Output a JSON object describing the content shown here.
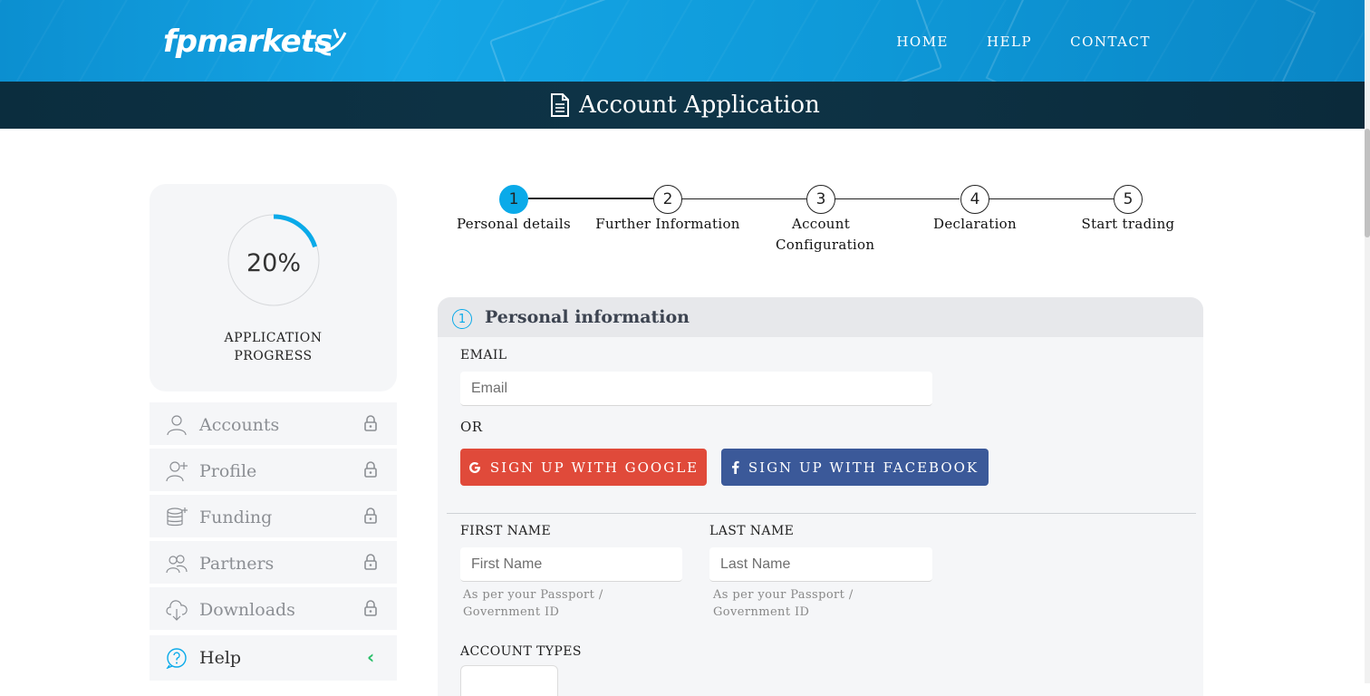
{
  "brand": {
    "logo_text": "fpmarkets"
  },
  "nav": {
    "items": [
      "HOME",
      "HELP",
      "CONTACT"
    ]
  },
  "titlebar": {
    "title": "Account Application"
  },
  "progress": {
    "value": 0.2,
    "value_label": "20%",
    "label_line1": "APPLICATION",
    "label_line2": "PROGRESS",
    "accent": "#0aaae9"
  },
  "sidebar": {
    "items": [
      {
        "label": "Accounts",
        "icon": "user-icon",
        "locked": true
      },
      {
        "label": "Profile",
        "icon": "user-plus-icon",
        "locked": true
      },
      {
        "label": "Funding",
        "icon": "coins-icon",
        "locked": true
      },
      {
        "label": "Partners",
        "icon": "users-icon",
        "locked": true
      },
      {
        "label": "Downloads",
        "icon": "cloud-download-icon",
        "locked": true
      },
      {
        "label": "Help",
        "icon": "help-icon",
        "chevron": "‹"
      }
    ]
  },
  "stepper": {
    "active": 1,
    "steps": [
      {
        "num": "1",
        "label": "Personal details"
      },
      {
        "num": "2",
        "label": "Further Information"
      },
      {
        "num": "3",
        "label": "Account Configuration"
      },
      {
        "num": "4",
        "label": "Declaration"
      },
      {
        "num": "5",
        "label": "Start trading"
      }
    ]
  },
  "form": {
    "section_num": "1",
    "section_title": "Personal information",
    "email_label": "EMAIL",
    "email_placeholder": "Email",
    "or_label": "OR",
    "google_label": "SIGN UP WITH GOOGLE",
    "facebook_label": "SIGN UP WITH FACEBOOK",
    "first_name_label": "FIRST NAME",
    "first_name_placeholder": "First Name",
    "last_name_label": "LAST NAME",
    "last_name_placeholder": "Last Name",
    "name_help_line1": "As per your Passport /",
    "name_help_line2": "Government ID",
    "account_types_label": "ACCOUNT TYPES"
  },
  "colors": {
    "google": "#e04a3a",
    "facebook": "#3b5999",
    "header_blue": "#15a6e6",
    "titlebar_dark": "#0e3447"
  }
}
